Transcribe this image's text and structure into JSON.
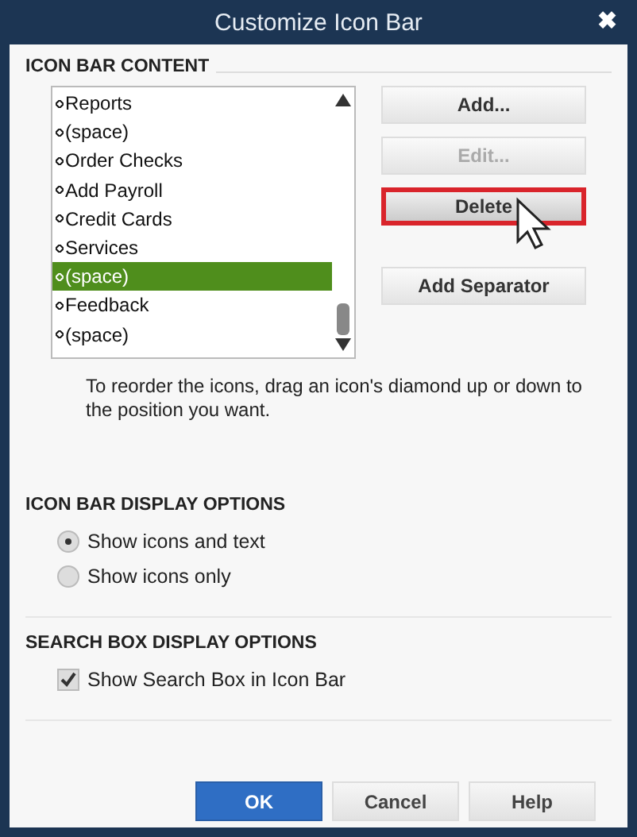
{
  "window": {
    "title": "Customize Icon Bar",
    "close": "✖"
  },
  "content": {
    "heading": "ICON BAR CONTENT",
    "items": [
      {
        "label": "Reports",
        "selected": false
      },
      {
        "label": "(space)",
        "selected": false
      },
      {
        "label": "Order Checks",
        "selected": false
      },
      {
        "label": "Add Payroll",
        "selected": false
      },
      {
        "label": "Credit Cards",
        "selected": false
      },
      {
        "label": "Services",
        "selected": false
      },
      {
        "label": "(space)",
        "selected": true
      },
      {
        "label": "Feedback",
        "selected": false
      },
      {
        "label": "(space)",
        "selected": false
      }
    ],
    "buttons": [
      {
        "label": "Add...",
        "disabled": false,
        "highlighted": false
      },
      {
        "label": "Edit...",
        "disabled": true,
        "highlighted": false
      },
      {
        "label": "Delete",
        "disabled": false,
        "highlighted": true
      },
      {
        "label": "Add Separator",
        "disabled": false,
        "highlighted": false
      }
    ],
    "hint": "To reorder the icons, drag an icon's diamond up or down to the position you want."
  },
  "display_options": {
    "heading": "ICON BAR DISPLAY OPTIONS",
    "options": [
      {
        "label": "Show icons and text",
        "selected": true
      },
      {
        "label": "Show icons only",
        "selected": false
      }
    ]
  },
  "search_options": {
    "heading": "SEARCH BOX DISPLAY OPTIONS",
    "checkbox": {
      "label": "Show Search Box in Icon Bar",
      "checked": true
    }
  },
  "footer_buttons": [
    {
      "label": "OK",
      "primary": true
    },
    {
      "label": "Cancel",
      "primary": false
    },
    {
      "label": "Help",
      "primary": false
    }
  ]
}
